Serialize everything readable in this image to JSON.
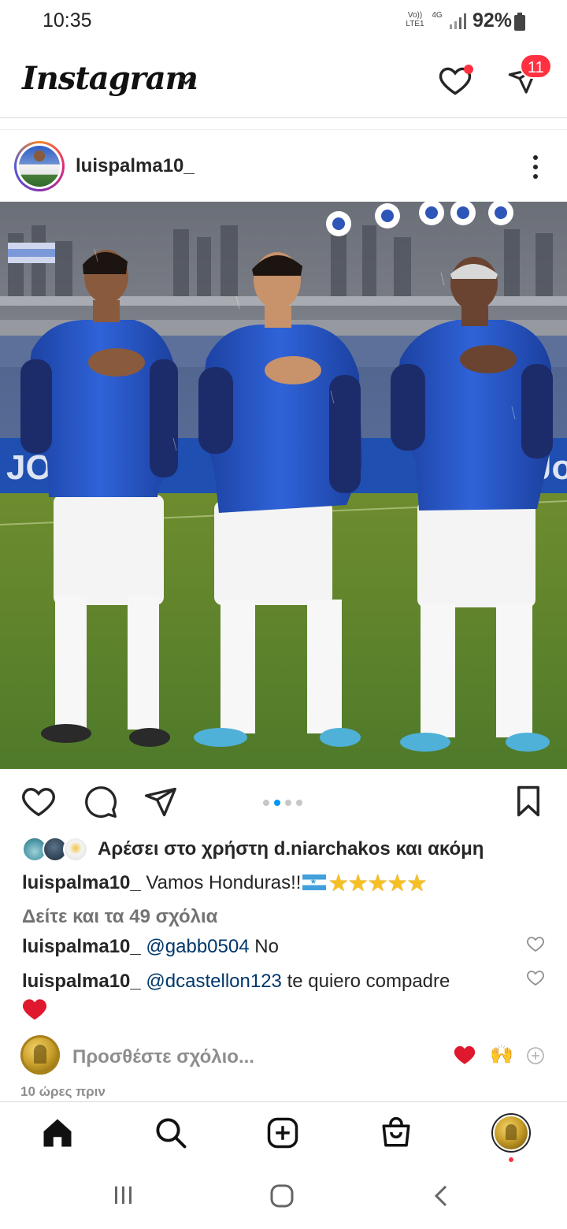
{
  "status_bar": {
    "time": "10:35",
    "network_label": "Vo)) LTE1",
    "network_type": "4G",
    "battery": "92%"
  },
  "header": {
    "logo": "Instagram",
    "icons": [
      "chevron-down-icon",
      "heart-icon",
      "direct-send-icon"
    ],
    "messages_badge": "11"
  },
  "post": {
    "username": "luispalma10_",
    "carousel": {
      "count": 4,
      "active_index": 1
    },
    "likes_text": "Αρέσει στο χρήστη d.niarchakos και ακόμη",
    "caption": {
      "username": "luispalma10_",
      "text": "Vamos Honduras!!",
      "stars": "★★★★★"
    },
    "view_comments": "Δείτε και τα 49 σχόλια",
    "comments": [
      {
        "username": "luispalma10_",
        "mention": "@gabb0504",
        "text": " No"
      },
      {
        "username": "luispalma10_",
        "mention": "@dcastellon123",
        "text": " te quiero compadre"
      }
    ],
    "add_comment_placeholder": "Προσθέστε σχόλιο...",
    "quick_reactions": [
      "red-heart-icon",
      "raised-hands-icon",
      "plus-icon"
    ],
    "time_ago": "10 ώρες πριν"
  },
  "bottom_nav": [
    "home-icon",
    "search-icon",
    "create-icon",
    "shop-icon",
    "profile-avatar"
  ],
  "colors": {
    "accent_blue": "#0095f6",
    "notification_red": "#ff3040",
    "mention_blue": "#00376b",
    "secondary_text": "#737373"
  }
}
